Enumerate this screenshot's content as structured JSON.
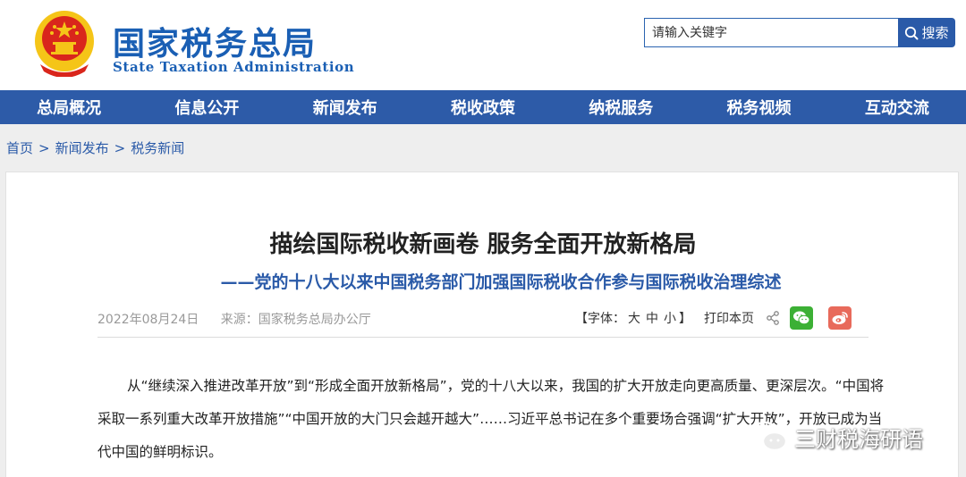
{
  "header": {
    "title_cn": "国家税务总局",
    "title_en": "State Taxation Administration",
    "emblem_icon": "national-emblem-icon"
  },
  "search": {
    "placeholder": "请输入关键字",
    "button_label": "搜索",
    "icon": "search-icon"
  },
  "nav": {
    "items": [
      "总局概况",
      "信息公开",
      "新闻发布",
      "税收政策",
      "纳税服务",
      "税务视频",
      "互动交流"
    ]
  },
  "breadcrumb": {
    "items": [
      "首页",
      "新闻发布",
      "税务新闻"
    ],
    "separator": ">"
  },
  "article": {
    "title": "描绘国际税收新画卷 服务全面开放新格局",
    "subtitle": "——党的十八大以来中国税务部门加强国际税收合作参与国际税收治理综述",
    "date": "2022年08月24日",
    "source": "来源：国家税务总局办公厅",
    "font_size_label_open": "【字体：",
    "font_sizes": [
      "大",
      "中",
      "小"
    ],
    "font_size_label_close": "】",
    "print_label": "打印本页",
    "share_icons": [
      "share-icon",
      "wechat-icon",
      "weibo-icon"
    ],
    "paragraph": "从“继续深入推进改革开放”到“形成全面开放新格局”，党的十八大以来，我国的扩大开放走向更高质量、更深层次。“中国将采取一系列重大改革开放措施”“中国开放的大门只会越开越大”……习近平总书记在多个重要场合强调“扩大开放”，开放已成为当代中国的鲜明标识。"
  },
  "watermark": {
    "text": "三财税海研语",
    "icon": "wechat-watermark-icon"
  },
  "colors": {
    "brand_blue": "#1a5fb4",
    "nav_blue": "#2d5ba8",
    "emblem_red": "#d9261c",
    "emblem_gold": "#f5c518",
    "wechat_green": "#3cb035",
    "weibo_red": "#e86a5b"
  }
}
